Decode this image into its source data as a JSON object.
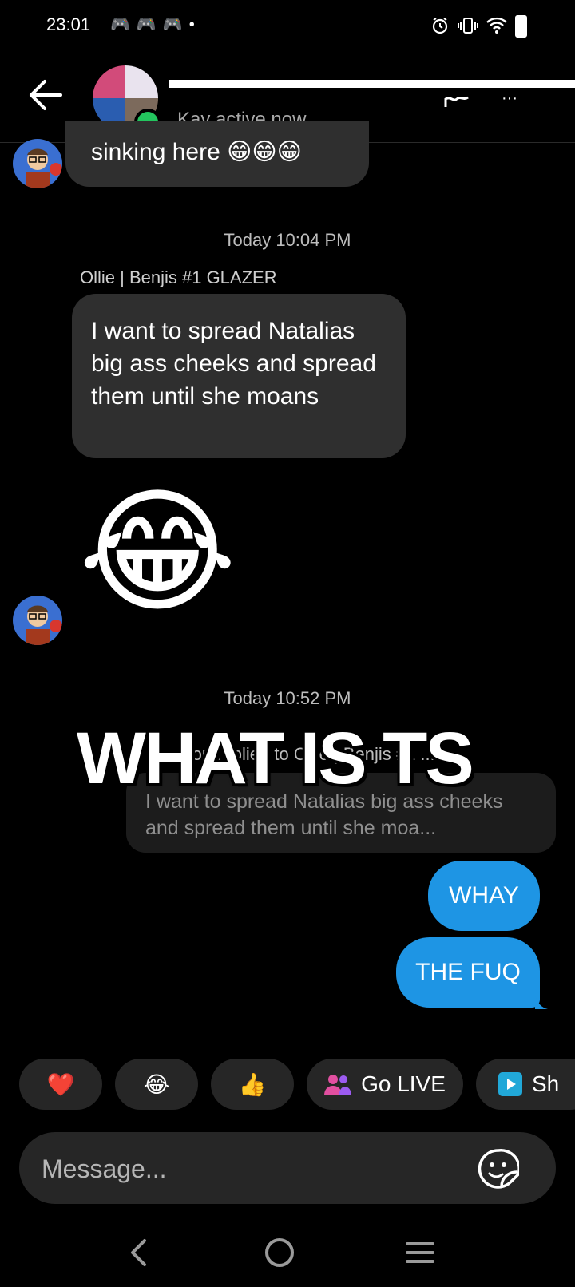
{
  "status_bar": {
    "time": "23:01",
    "notification_icons": [
      "discord-icon",
      "discord-icon",
      "discord-icon",
      "dot"
    ],
    "right_icons": [
      "alarm-icon",
      "vibrate-icon",
      "wifi-icon",
      "battery-icon"
    ]
  },
  "header": {
    "subtitle": "Kay active now"
  },
  "messages": {
    "partial_top": {
      "text": "sinking here 😁😁😁"
    },
    "timestamp_1": "Today 10:04 PM",
    "sender_1": "Ollie | Benjis #1 GLAZER",
    "incoming_1": {
      "text": "I want to spread Natalias big ass cheeks and spread them until she moans"
    },
    "incoming_emoji": "😂",
    "timestamp_2": "Today 10:52 PM",
    "reply_header": "You replied to Ollie | Benjis #1 ...",
    "reply_quote": "I want to spread Natalias big ass cheeks and spread them until she moa...",
    "outgoing": [
      {
        "text": "WHAY"
      },
      {
        "text": "THE FUQ"
      }
    ]
  },
  "overlay": {
    "meme_caption": "WHAT IS TS"
  },
  "reactions": [
    {
      "emoji": "❤️",
      "label": ""
    },
    {
      "emoji": "😂",
      "label": ""
    },
    {
      "emoji": "👍",
      "label": ""
    },
    {
      "emoji": "👥",
      "label": "Go LIVE"
    },
    {
      "emoji": "▶",
      "label": "Sh"
    }
  ],
  "composer": {
    "placeholder": "Message..."
  },
  "colors": {
    "accent_blue": "#1e95e4",
    "bubble_gray": "#2f2f2f",
    "online_green": "#23c55e",
    "background": "#000000"
  }
}
